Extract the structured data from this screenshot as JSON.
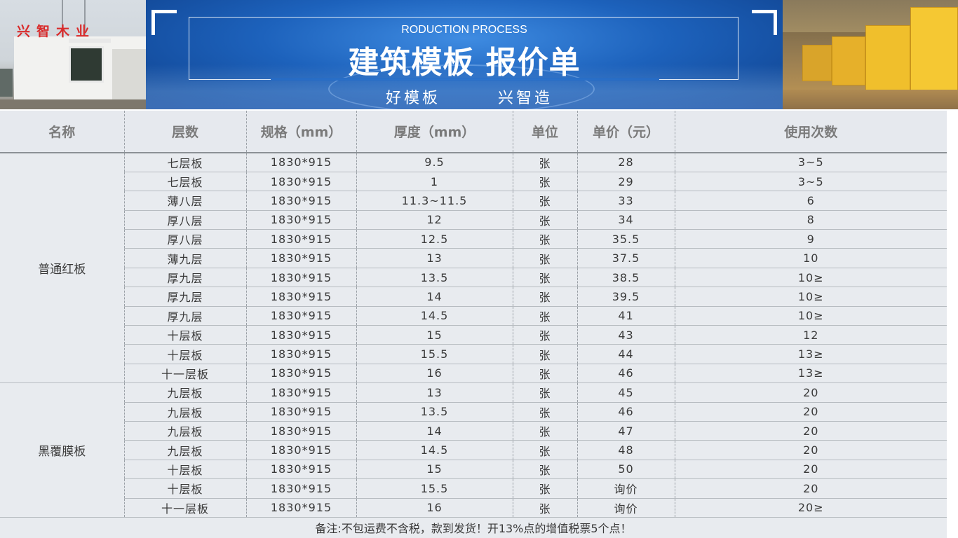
{
  "header": {
    "logo_sign": "兴智木业",
    "subtitle": "RODUCTION PROCESS",
    "title": "建筑模板 报价单",
    "slogan_left": "好模板",
    "slogan_right": "兴智造"
  },
  "table": {
    "columns": [
      "名称",
      "层数",
      "规格（mm）",
      "厚度（mm）",
      "单位",
      "单价（元）",
      "使用次数"
    ],
    "groups": [
      {
        "name": "普通红板",
        "rows": [
          [
            "七层板",
            "1830*915",
            "9.5",
            "张",
            "28",
            "3~5"
          ],
          [
            "七层板",
            "1830*915",
            "1",
            "张",
            "29",
            "3~5"
          ],
          [
            "薄八层",
            "1830*915",
            "11.3~11.5",
            "张",
            "33",
            "6"
          ],
          [
            "厚八层",
            "1830*915",
            "12",
            "张",
            "34",
            "8"
          ],
          [
            "厚八层",
            "1830*915",
            "12.5",
            "张",
            "35.5",
            "9"
          ],
          [
            "薄九层",
            "1830*915",
            "13",
            "张",
            "37.5",
            "10"
          ],
          [
            "厚九层",
            "1830*915",
            "13.5",
            "张",
            "38.5",
            "10≥"
          ],
          [
            "厚九层",
            "1830*915",
            "14",
            "张",
            "39.5",
            "10≥"
          ],
          [
            "厚九层",
            "1830*915",
            "14.5",
            "张",
            "41",
            "10≥"
          ],
          [
            "十层板",
            "1830*915",
            "15",
            "张",
            "43",
            "12"
          ],
          [
            "十层板",
            "1830*915",
            "15.5",
            "张",
            "44",
            "13≥"
          ],
          [
            "十一层板",
            "1830*915",
            "16",
            "张",
            "46",
            "13≥"
          ]
        ]
      },
      {
        "name": "黑覆膜板",
        "rows": [
          [
            "九层板",
            "1830*915",
            "13",
            "张",
            "45",
            "20"
          ],
          [
            "九层板",
            "1830*915",
            "13.5",
            "张",
            "46",
            "20"
          ],
          [
            "九层板",
            "1830*915",
            "14",
            "张",
            "47",
            "20"
          ],
          [
            "九层板",
            "1830*915",
            "14.5",
            "张",
            "48",
            "20"
          ],
          [
            "十层板",
            "1830*915",
            "15",
            "张",
            "50",
            "20"
          ],
          [
            "十层板",
            "1830*915",
            "15.5",
            "张",
            "询价",
            "20"
          ],
          [
            "十一层板",
            "1830*915",
            "16",
            "张",
            "询价",
            "20≥"
          ]
        ]
      }
    ],
    "note": "备注:不包运费不含税，款到发货！开13%点的增值税票5个点！"
  },
  "colors": {
    "banner_blue": "#1d62bc",
    "table_bg": "#e8ebef",
    "header_text": "#7a7a7a",
    "sign_red": "#d92b2b",
    "board_yellow": "#f0bf2c"
  }
}
